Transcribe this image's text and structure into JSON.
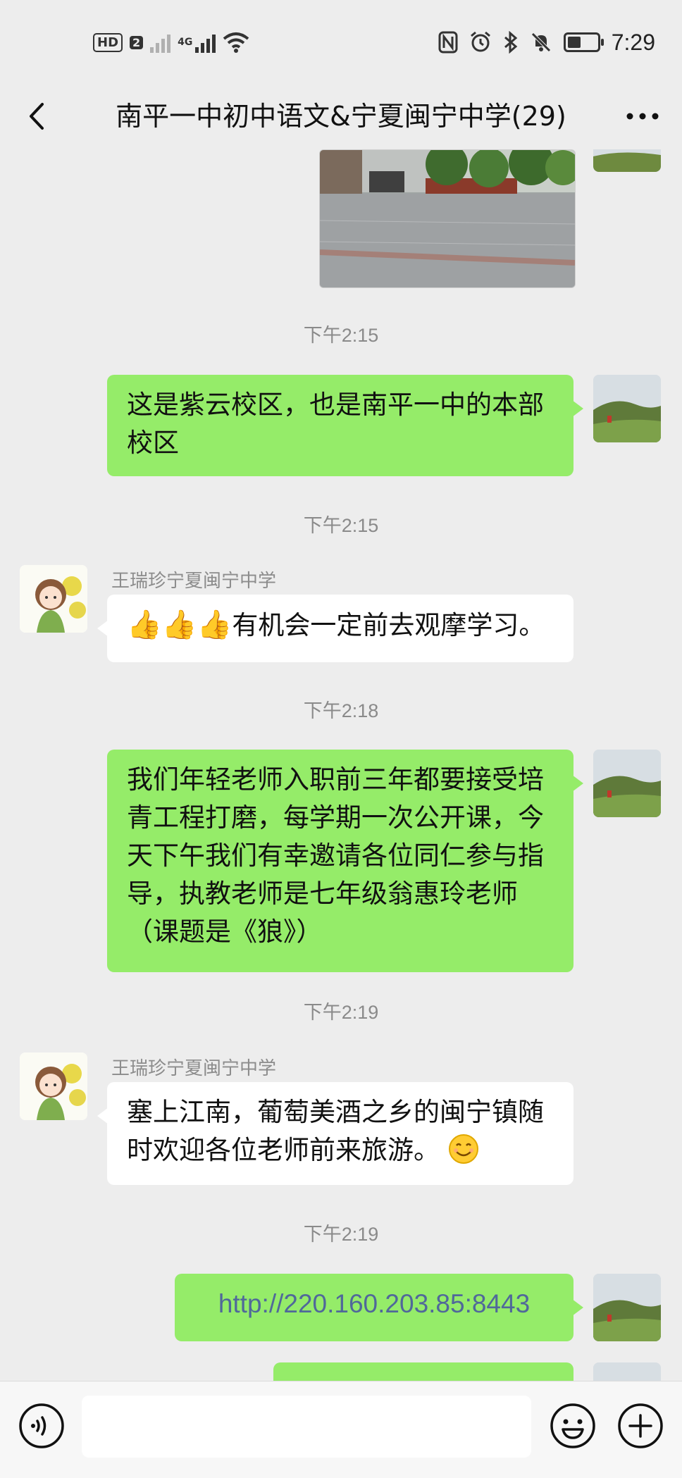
{
  "status_bar": {
    "network_badge": "HD",
    "sim_slot": "2",
    "network_type": "4G",
    "time": "7:29",
    "icons": [
      "nfc-icon",
      "alarm-icon",
      "bluetooth-icon",
      "mute-icon",
      "battery-icon"
    ]
  },
  "nav": {
    "back_icon": "back-chevron-icon",
    "title": "南平一中初中语文&宁夏闽宁中学(29)",
    "more_icon": "more-dots-icon"
  },
  "messages": [
    {
      "type": "image",
      "side": "me",
      "description_icon": "campus-photo"
    },
    {
      "type": "time",
      "text": "下午2:15"
    },
    {
      "type": "text",
      "side": "me",
      "text": "这是紫云校区，也是南平一中的本部校区"
    },
    {
      "type": "time",
      "text": "下午2:15"
    },
    {
      "type": "text",
      "side": "other",
      "sender": "王瑞珍宁夏闽宁中学",
      "prefix": "👍👍👍",
      "text": "有机会一定前去观摩学习。"
    },
    {
      "type": "time",
      "text": "下午2:18"
    },
    {
      "type": "text",
      "side": "me",
      "text": "我们年轻老师入职前三年都要接受培青工程打磨，每学期一次公开课，今天下午我们有幸邀请各位同仁参与指导，执教老师是七年级翁惠玲老师（课题是《狼》）"
    },
    {
      "type": "time",
      "text": "下午2:19"
    },
    {
      "type": "text",
      "side": "other",
      "sender": "王瑞珍宁夏闽宁中学",
      "text": "塞上江南，葡萄美酒之乡的闽宁镇随时欢迎各位老师前来旅游。",
      "suffix_icon": "smile-emoji-icon"
    },
    {
      "type": "time",
      "text": "下午2:19"
    },
    {
      "type": "link",
      "side": "me",
      "text": "http://220.160.203.85:8443"
    }
  ],
  "input_bar": {
    "voice_icon": "voice-icon",
    "placeholder": "",
    "emoji_icon": "emoji-icon",
    "plus_icon": "plus-icon"
  }
}
